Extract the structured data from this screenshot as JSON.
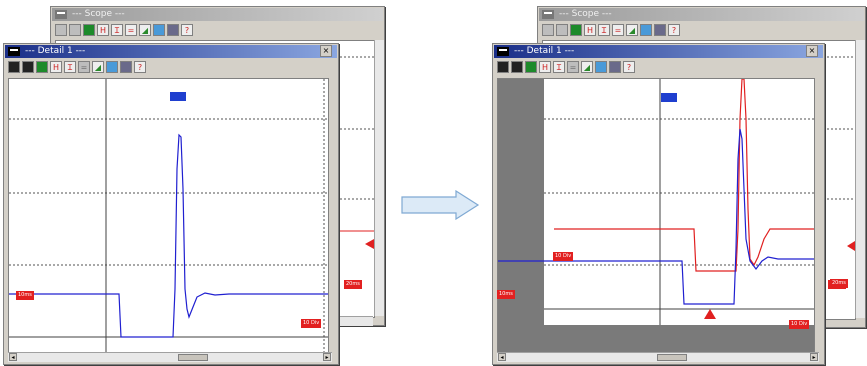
{
  "panels": {
    "left": {
      "back_window": {
        "title": "--- Scope ---"
      },
      "front_window": {
        "title": "--- Detail 1 ---",
        "close": "×",
        "badges": [
          "10ms",
          "10 Div",
          "20ms"
        ]
      }
    },
    "right": {
      "back_window": {
        "title": "--- Scope ---"
      },
      "front_window": {
        "title": "--- Detail 1 ---",
        "close": "×",
        "badges": [
          "10 Div",
          "10ms",
          "10 Div",
          "20ms"
        ]
      }
    }
  },
  "toolbar": {
    "buttons": [
      "dark-chart-icon",
      "stack-icon",
      "channel-icon",
      "cursor-h-icon",
      "cursor-v-icon",
      "measure-icon",
      "zoom-icon",
      "grid-icon",
      "fit-icon",
      "help-icon"
    ],
    "glyphs": [
      "▬",
      "▬",
      "■",
      "H",
      "Ɪ",
      "=",
      "◢",
      "▦",
      "▩",
      "?"
    ]
  },
  "arrow": {
    "glyph": "⇨"
  },
  "colors": {
    "trace_blue": "#2020d0",
    "trace_red": "#e02020",
    "title_active": "#1a2e88",
    "window_face": "#d4d0c8"
  },
  "traces": {
    "left_blue": "step down then positive spike with ringing",
    "right_blue": "step down then positive spike with ringing",
    "right_red": "step down then large positive spike with ringing"
  }
}
